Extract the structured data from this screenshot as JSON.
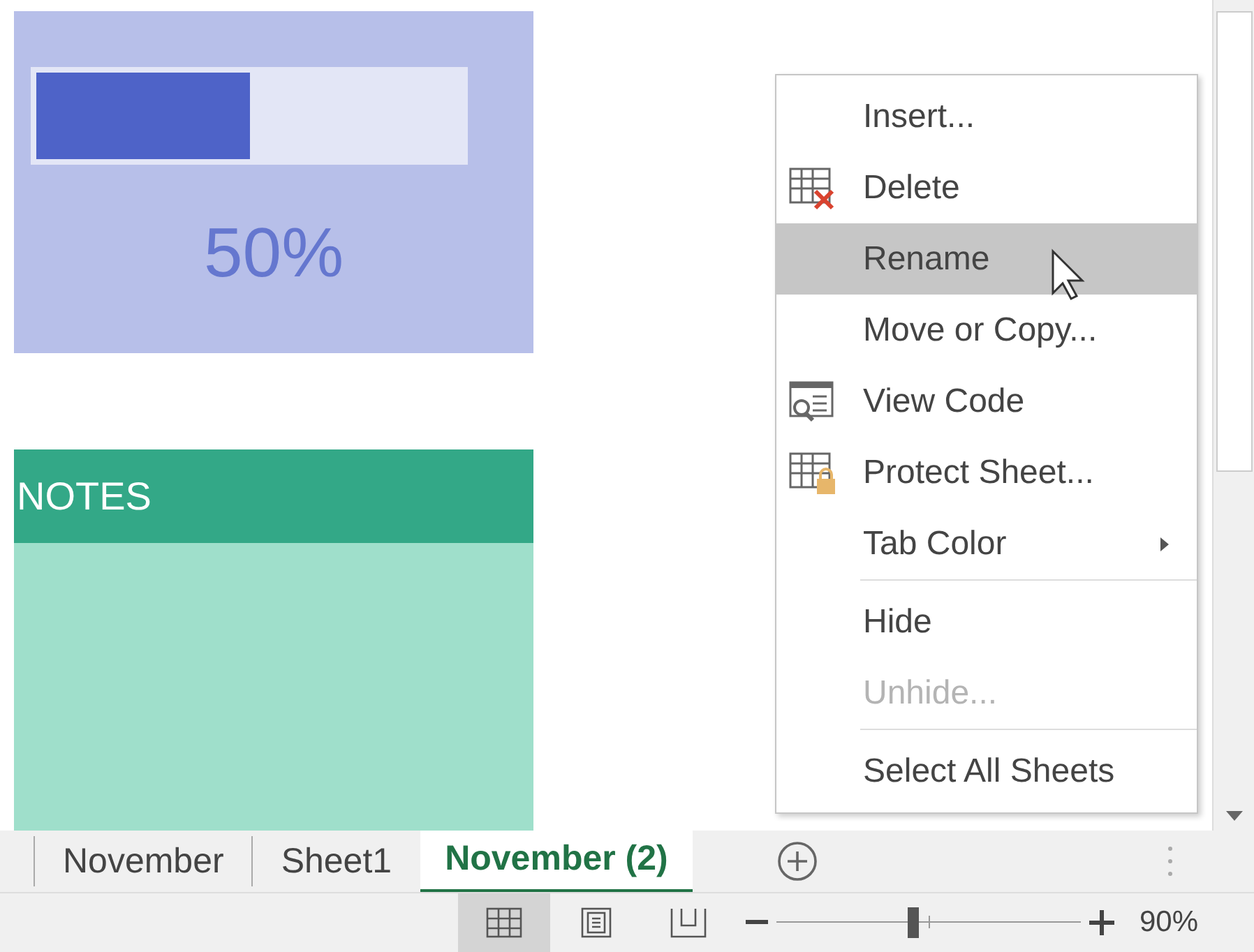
{
  "progress_card": {
    "level": 0.5,
    "reading": "50%"
  },
  "notes_card": {
    "title": "NOTES"
  },
  "context_menu": {
    "items": [
      {
        "label": "Insert...",
        "kind": "plain",
        "selected": false,
        "disabled": false,
        "submenu": false,
        "separator_before": false
      },
      {
        "label": "Delete",
        "kind": "delete",
        "selected": false,
        "disabled": false,
        "submenu": false,
        "separator_before": false
      },
      {
        "label": "Rename",
        "kind": "plain",
        "selected": true,
        "disabled": false,
        "submenu": false,
        "separator_before": false
      },
      {
        "label": "Move or Copy...",
        "kind": "plain",
        "selected": false,
        "disabled": false,
        "submenu": false,
        "separator_before": false
      },
      {
        "label": "View Code",
        "kind": "code",
        "selected": false,
        "disabled": false,
        "submenu": false,
        "separator_before": false
      },
      {
        "label": "Protect Sheet...",
        "kind": "protect",
        "selected": false,
        "disabled": false,
        "submenu": false,
        "separator_before": false
      },
      {
        "label": "Tab Color",
        "kind": "plain",
        "selected": false,
        "disabled": false,
        "submenu": true,
        "separator_before": false
      },
      {
        "label": "Hide",
        "kind": "plain",
        "selected": false,
        "disabled": false,
        "submenu": false,
        "separator_before": true
      },
      {
        "label": "Unhide...",
        "kind": "plain",
        "selected": false,
        "disabled": true,
        "submenu": false,
        "separator_before": false
      },
      {
        "label": "Select All Sheets",
        "kind": "plain",
        "selected": false,
        "disabled": false,
        "submenu": false,
        "separator_before": true
      }
    ]
  },
  "sheet_tabs": [
    {
      "label": "November",
      "selected": false
    },
    {
      "label": "Sheet1",
      "selected": false
    },
    {
      "label": "November (2)",
      "selected": true
    }
  ],
  "status_bar": {
    "views": [
      {
        "kind": "normal",
        "selected": true
      },
      {
        "kind": "layout",
        "selected": false
      },
      {
        "kind": "break",
        "selected": false
      }
    ],
    "zoom": {
      "level": 0.45,
      "reading": "90%"
    }
  }
}
